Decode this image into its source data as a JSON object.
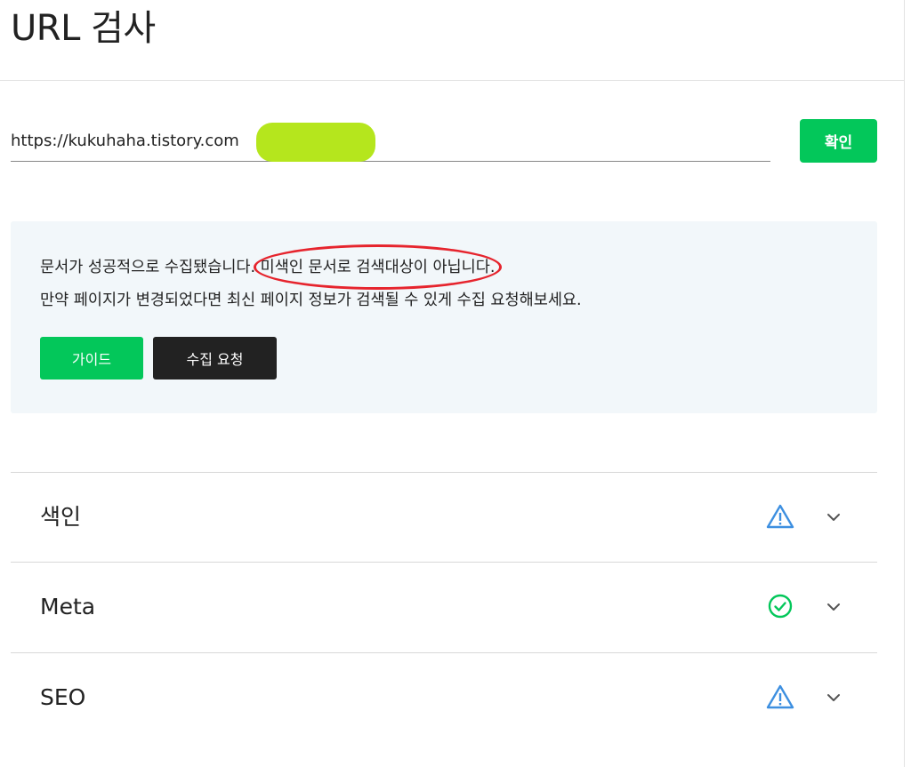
{
  "page": {
    "title": "URL 검사"
  },
  "search": {
    "url_value": "https://kukuhaha.tistory.com",
    "confirm_label": "확인"
  },
  "result": {
    "message_part1": "문서가 성공적으로 수집됐습니다.",
    "message_highlight": "미색인 문서로 검색대상이 아닙니다.",
    "message_line2": "만약 페이지가 변경되었다면 최신 페이지 정보가 검색될 수 있게 수집 요청해보세요.",
    "guide_label": "가이드",
    "crawl_request_label": "수집 요청"
  },
  "sections": [
    {
      "label": "색인",
      "status": "warning",
      "status_icon": "warning-triangle-icon",
      "status_color": "#3d8fe0"
    },
    {
      "label": "Meta",
      "status": "ok",
      "status_icon": "check-circle-icon",
      "status_color": "#03c75a"
    },
    {
      "label": "SEO",
      "status": "warning",
      "status_icon": "warning-triangle-icon",
      "status_color": "#3d8fe0"
    }
  ],
  "colors": {
    "accent_green": "#03c75a",
    "dark_button": "#222222",
    "panel_background": "#f2f7fa",
    "annotation_red": "#e6242d",
    "redaction_green": "#b5e61d"
  }
}
